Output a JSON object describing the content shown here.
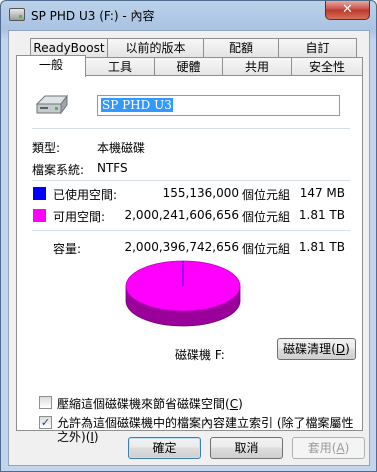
{
  "window": {
    "title": "SP PHD U3 (F:) - 內容",
    "close_label": "✕"
  },
  "tabs_back": [
    "ReadyBoost",
    "以前的版本",
    "配額",
    "自訂"
  ],
  "tabs_front": [
    "一般",
    "工具",
    "硬體",
    "共用",
    "安全性"
  ],
  "general": {
    "volume_label": "SP PHD U3",
    "type_label": "類型:",
    "type_value": "本機磁碟",
    "fs_label": "檔案系統:",
    "fs_value": "NTFS",
    "used": {
      "label": "已使用空間:",
      "bytes": "155,136,000",
      "unit": "個位元組",
      "size": "147 MB",
      "color": "#0000ff"
    },
    "free": {
      "label": "可用空間:",
      "bytes": "2,000,241,606,656",
      "unit": "個位元組",
      "size": "1.81 TB",
      "color": "#ff00ff"
    },
    "capacity": {
      "label": "容量:",
      "bytes": "2,000,396,742,656",
      "unit": "個位元組",
      "size": "1.81 TB"
    },
    "used_fraction": 7.76e-05,
    "drive_caption": "磁碟機 F:",
    "cleanup_button": "磁碟清理",
    "cleanup_key": "D",
    "compress_label": "壓縮這個磁碟機來節省磁碟空間",
    "compress_key": "C",
    "compress_checked": false,
    "index_label_1": "允許為這個磁碟機中的檔案內容建立索引 (除了檔案屬性",
    "index_label_2": "之外)",
    "index_key": "I",
    "index_checked": true
  },
  "buttons": {
    "ok": "確定",
    "cancel": "取消",
    "apply": "套用",
    "apply_key": "A"
  }
}
